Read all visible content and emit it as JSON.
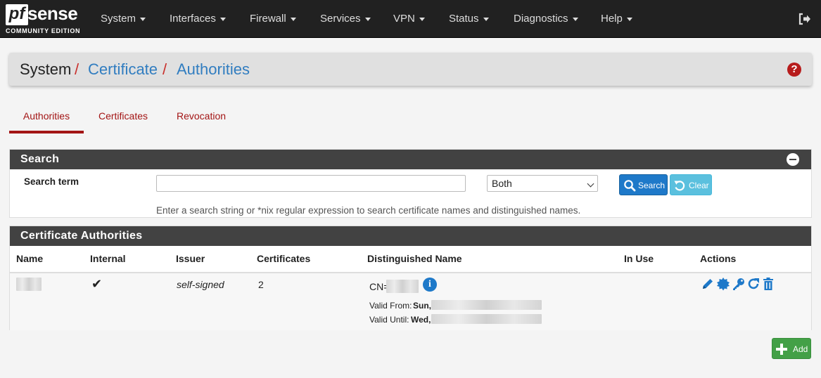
{
  "brand": {
    "logo_pf": "pf",
    "logo_sense": "sense",
    "edition": "COMMUNITY EDITION"
  },
  "nav": [
    {
      "label": "System"
    },
    {
      "label": "Interfaces"
    },
    {
      "label": "Firewall"
    },
    {
      "label": "Services"
    },
    {
      "label": "VPN"
    },
    {
      "label": "Status"
    },
    {
      "label": "Diagnostics"
    },
    {
      "label": "Help"
    }
  ],
  "breadcrumb": {
    "root": "System",
    "sep1": "/",
    "level1": "Certificate",
    "sep2": "/",
    "level2": "Authorities",
    "help": "?"
  },
  "tabs": [
    {
      "label": "Authorities",
      "active": true
    },
    {
      "label": "Certificates",
      "active": false
    },
    {
      "label": "Revocation",
      "active": false
    }
  ],
  "search": {
    "title": "Search",
    "term_label": "Search term",
    "term_value": "",
    "scope_selected": "Both",
    "search_button": "Search",
    "clear_button": "Clear",
    "help_text": "Enter a search string or *nix regular expression to search certificate names and distinguished names."
  },
  "ca_panel": {
    "title": "Certificate Authorities",
    "columns": [
      "Name",
      "Internal",
      "Issuer",
      "Certificates",
      "Distinguished Name",
      "In Use",
      "Actions"
    ],
    "rows": [
      {
        "name": "",
        "internal": "✔",
        "issuer": "self-signed",
        "certificates": "2",
        "dn_prefix": "CN=",
        "valid_from_label": "Valid From:",
        "valid_from_day": "Sun,",
        "valid_until_label": "Valid Until:",
        "valid_until_day": "Wed,",
        "in_use": ""
      }
    ]
  },
  "add_button": "Add",
  "colors": {
    "navbar": "#212121",
    "link": "#317dc0",
    "tab_accent": "#a31515",
    "panel_head": "#424242",
    "primary": "#1e79c9",
    "info": "#5bc0de",
    "success": "#43a047"
  }
}
